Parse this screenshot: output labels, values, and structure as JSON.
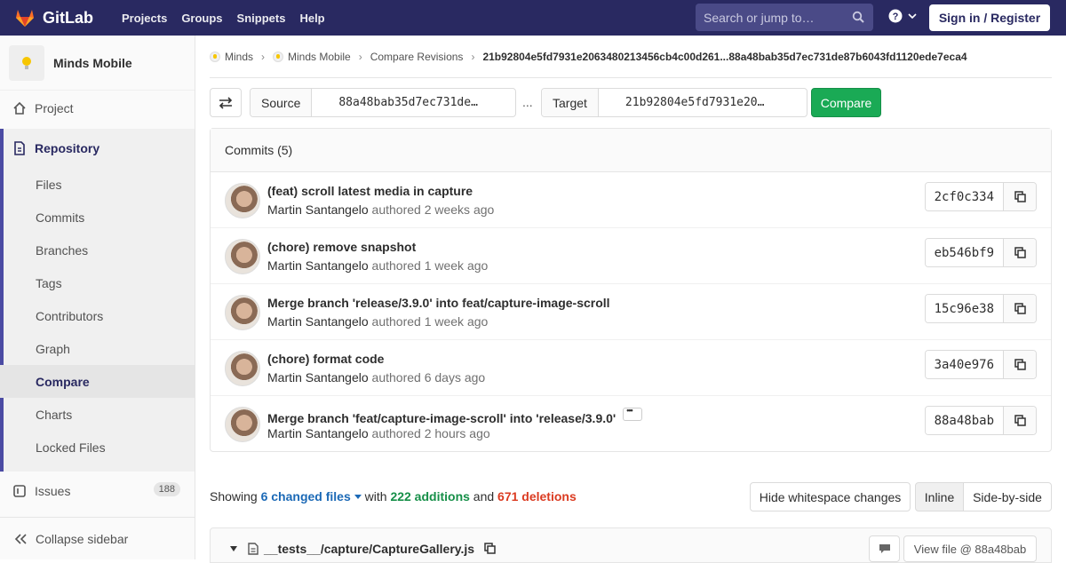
{
  "navbar": {
    "brand": "GitLab",
    "links": [
      "Projects",
      "Groups",
      "Snippets",
      "Help"
    ],
    "search_placeholder": "Search or jump to…",
    "signin_label": "Sign in / Register"
  },
  "sidebar": {
    "project_name": "Minds Mobile",
    "project_label": "Project",
    "repository_label": "Repository",
    "items": [
      "Files",
      "Commits",
      "Branches",
      "Tags",
      "Contributors",
      "Graph",
      "Compare",
      "Charts",
      "Locked Files"
    ],
    "issues_label": "Issues",
    "issues_count": "188",
    "collapse_label": "Collapse sidebar"
  },
  "breadcrumb": {
    "items": [
      "Minds",
      "Minds Mobile",
      "Compare Revisions"
    ],
    "current": "21b92804e5fd7931e2063480213456cb4c00d261...88a48bab35d7ec731de87b6043fd1120ede7eca4"
  },
  "compare": {
    "source_label": "Source",
    "source_value": "88a48bab35d7ec731de…",
    "dots": "...",
    "target_label": "Target",
    "target_value": "21b92804e5fd7931e20…",
    "button_label": "Compare"
  },
  "commits": {
    "header": "Commits (5)",
    "authored_word": "authored",
    "list": [
      {
        "title": "(feat) scroll latest media in capture",
        "author": "Martin Santangelo",
        "time": "2 weeks ago",
        "sha": "2cf0c334"
      },
      {
        "title": "(chore) remove snapshot",
        "author": "Martin Santangelo",
        "time": "1 week ago",
        "sha": "eb546bf9"
      },
      {
        "title": "Merge branch 'release/3.9.0' into feat/capture-image-scroll",
        "author": "Martin Santangelo",
        "time": "1 week ago",
        "sha": "15c96e38"
      },
      {
        "title": "(chore) format code",
        "author": "Martin Santangelo",
        "time": "6 days ago",
        "sha": "3a40e976"
      },
      {
        "title": "Merge branch 'feat/capture-image-scroll' into 'release/3.9.0'",
        "author": "Martin Santangelo",
        "time": "2 hours ago",
        "sha": "88a48bab"
      }
    ]
  },
  "summary": {
    "showing": "Showing",
    "changed_files": "6 changed files",
    "with": "with",
    "additions": "222 additions",
    "and": "and",
    "deletions": "671 deletions"
  },
  "view_options": {
    "hide_whitespace": "Hide whitespace changes",
    "inline": "Inline",
    "side_by_side": "Side-by-side"
  },
  "file": {
    "name": "__tests__/capture/CaptureGallery.js",
    "view_file": "View file @ 88a48bab"
  },
  "colors": {
    "navbar": "#292961",
    "compare_green": "#1aaa55",
    "additions": "#168f48",
    "deletions": "#db3b21",
    "link": "#1b69b6"
  }
}
